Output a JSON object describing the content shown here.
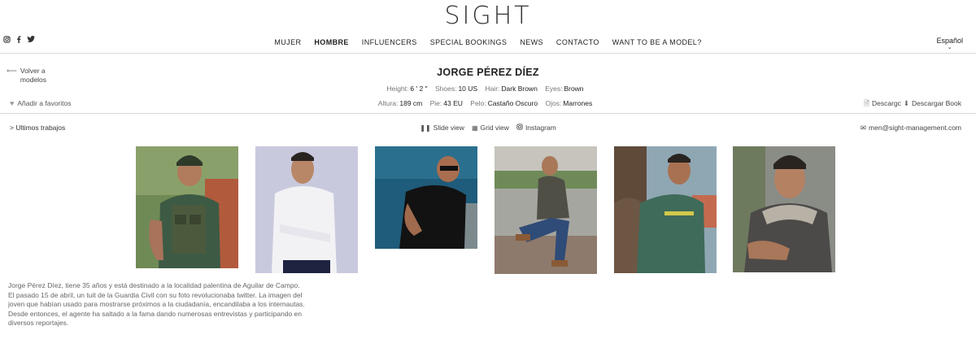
{
  "brand": "SIGHT",
  "social_icons": [
    "instagram-icon",
    "facebook-icon",
    "twitter-icon"
  ],
  "nav": {
    "items": [
      "MUJER",
      "HOMBRE",
      "INFLUENCERS",
      "SPECIAL BOOKINGS",
      "NEWS",
      "CONTACTO",
      "WANT TO BE A MODEL?"
    ],
    "active": "HOMBRE"
  },
  "language": {
    "label": "Español"
  },
  "back": {
    "label_line1": "Volver a",
    "label_line2": "modelos"
  },
  "model": {
    "name": "JORGE PÉREZ DÍEZ"
  },
  "stats_us": {
    "height_label": "Height:",
    "height_value": "6 ' 2 \"",
    "shoes_label": "Shoes:",
    "shoes_value": "10 US",
    "hair_label": "Hair:",
    "hair_value": "Dark Brown",
    "eyes_label": "Eyes:",
    "eyes_value": "Brown"
  },
  "stats_eu": {
    "height_label": "Altura:",
    "height_value": "189 cm",
    "shoes_label": "Pie:",
    "shoes_value": "43 EU",
    "hair_label": "Pelo:",
    "hair_value": "Castaño Oscuro",
    "eyes_label": "Ojos:",
    "eyes_value": "Marrones"
  },
  "favorites": {
    "label": "Añadir a favoritos"
  },
  "download": {
    "label": "Descargc",
    "label2": "Descargar Book"
  },
  "latest": {
    "label": "> Ultimos trabajos"
  },
  "views": {
    "slide": "Slide view",
    "grid": "Grid view",
    "instagram": "Instagram"
  },
  "contact": {
    "email": "men@sight-management.com"
  },
  "photos": [
    {
      "name": "photo-uniform-vest"
    },
    {
      "name": "photo-white-shirt"
    },
    {
      "name": "photo-black-tshirt-sunglasses"
    },
    {
      "name": "photo-seated-jeans"
    },
    {
      "name": "photo-green-polo"
    },
    {
      "name": "photo-fur-collar-jacket"
    }
  ],
  "bio": {
    "line1": "Jorge Pérez Díez, tiene 35 años y está destinado a la localidad palentina de Aguilar de Campo.",
    "line2": "El pasado 15 de abril, un tuit de la Guardia Civil con su foto revolucionaba twitter. La imagen del",
    "line3": "joven que habían usado para mostrarse próximos a la ciudadanía, encandilaba a los internautas.",
    "line4": "Desde entonces, el agente ha saltado a la fama dando numerosas entrevistas y participando en",
    "line5": "diversos reportajes."
  },
  "colors": {
    "rule": "#d9d9d9",
    "text": "#222222",
    "muted": "#777777"
  }
}
